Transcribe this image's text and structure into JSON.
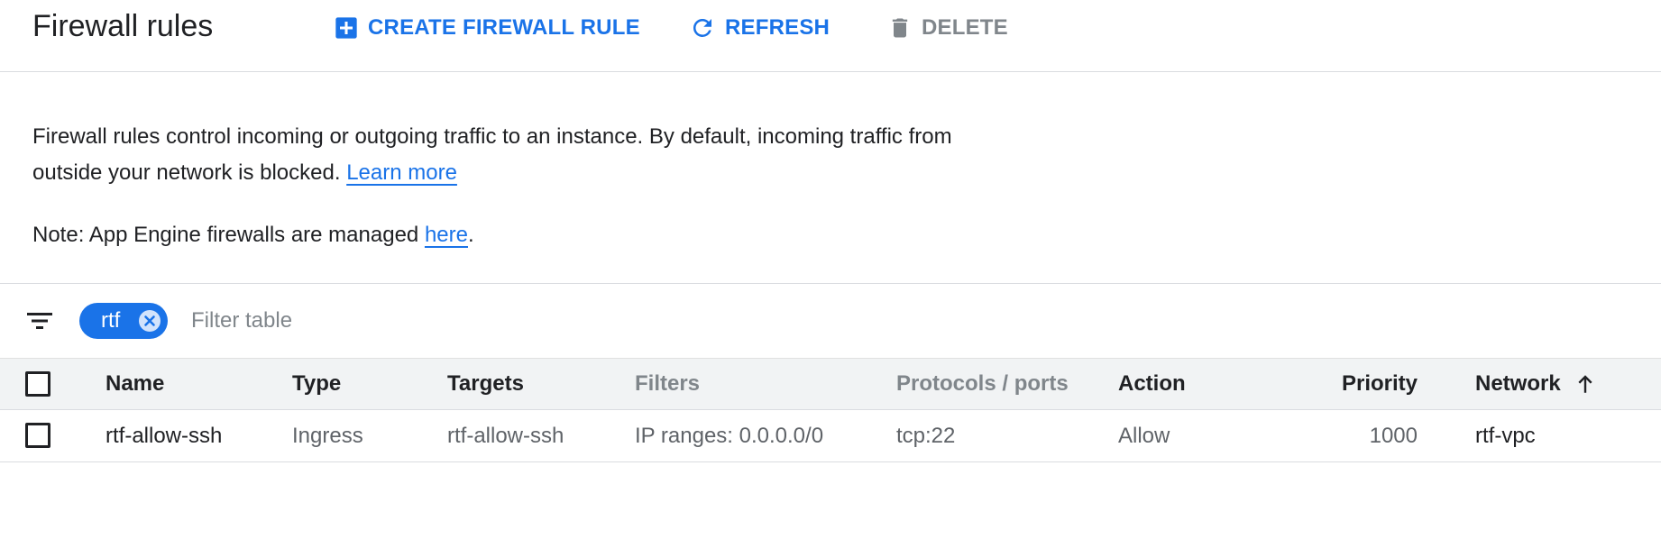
{
  "header": {
    "title": "Firewall rules",
    "create_label": "CREATE FIREWALL RULE",
    "refresh_label": "REFRESH",
    "delete_label": "DELETE"
  },
  "info": {
    "text": "Firewall rules control incoming or outgoing traffic to an instance. By default, incoming traffic from outside your network is blocked.",
    "learn_more": "Learn more",
    "note_prefix": "Note: App Engine firewalls are managed ",
    "note_link": "here",
    "note_suffix": "."
  },
  "filter": {
    "chip_label": "rtf",
    "placeholder": "Filter table"
  },
  "table": {
    "headers": {
      "name": "Name",
      "type": "Type",
      "targets": "Targets",
      "filters": "Filters",
      "protocols": "Protocols / ports",
      "action": "Action",
      "priority": "Priority",
      "network": "Network"
    },
    "rows": [
      {
        "name": "rtf-allow-ssh",
        "type": "Ingress",
        "targets": "rtf-allow-ssh",
        "filters": "IP ranges: 0.0.0.0/0",
        "protocols": "tcp:22",
        "action": "Allow",
        "priority": "1000",
        "network": "rtf-vpc"
      }
    ]
  },
  "icons": {
    "create": "add-box-icon",
    "refresh": "refresh-icon",
    "delete": "trash-icon",
    "filter": "filter-list-icon",
    "chip_close": "cancel-icon",
    "sort": "arrow-up-icon"
  },
  "colors": {
    "accent": "#1a73e8",
    "muted": "#80868b",
    "text": "#202124",
    "header_bg": "#f1f3f4",
    "divider": "#dadce0"
  }
}
